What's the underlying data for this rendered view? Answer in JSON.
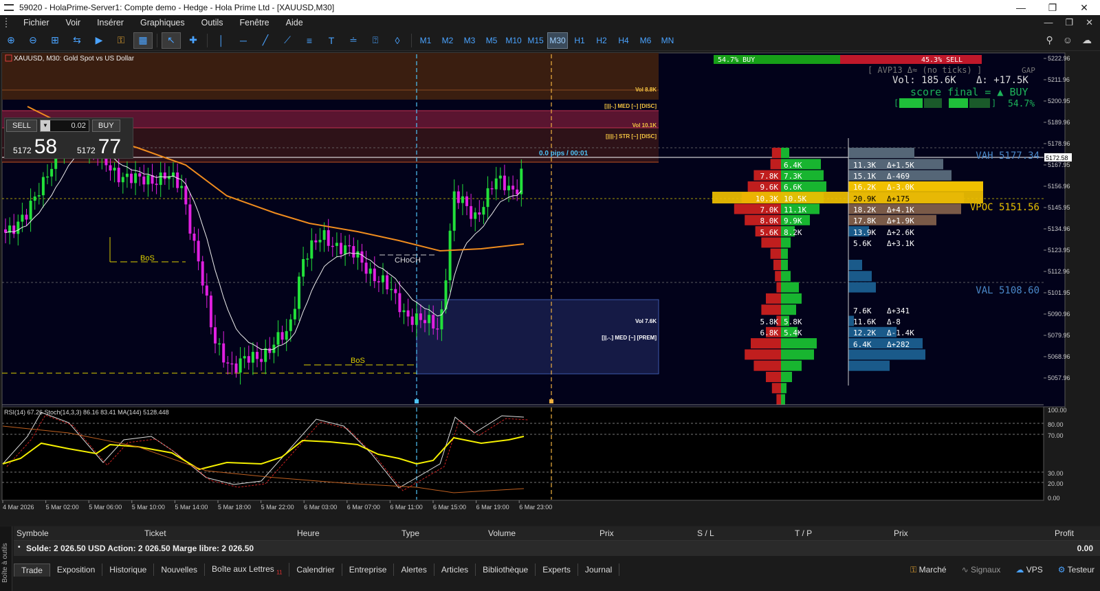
{
  "window": {
    "title": "59020 - HolaPrime-Server1: Compte demo - Hedge - Hola Prime Ltd - [XAUUSD,M30]"
  },
  "menu": [
    "Fichier",
    "Voir",
    "Insérer",
    "Graphiques",
    "Outils",
    "Fenêtre",
    "Aide"
  ],
  "timeframes": [
    "M1",
    "M2",
    "M3",
    "M5",
    "M10",
    "M15",
    "M30",
    "H1",
    "H2",
    "H4",
    "M6",
    "MN"
  ],
  "active_timeframe": "M30",
  "chart": {
    "symbol_label": "XAUUSD, M30:  Gold Spot vs US Dollar",
    "current_price_tag": "5172.58",
    "price_axis": [
      "5222.96",
      "5211.96",
      "5200.95",
      "5189.96",
      "5178.96",
      "5167.95",
      "5156.96",
      "5145.95",
      "5134.96",
      "5123.95",
      "5112.96",
      "5101.95",
      "5090.96",
      "5079.95",
      "5068.96",
      "5057.96"
    ],
    "time_axis": [
      "4 Mar 2026",
      "5 Mar 02:00",
      "5 Mar 06:00",
      "5 Mar 10:00",
      "5 Mar 14:00",
      "5 Mar 18:00",
      "5 Mar 22:00",
      "6 Mar 03:00",
      "6 Mar 07:00",
      "6 Mar 11:00",
      "6 Mar 15:00",
      "6 Mar 19:00",
      "6 Mar 23:00"
    ],
    "labels": {
      "bos1": "BoS",
      "bos2": "BoS",
      "choch": "CHoCH",
      "pips": "0.0 pips / 00:01",
      "vol88": "Vol 8.8K",
      "med_disc": "[|||-.] MED [~] [DISC]",
      "vol101": "Vol 10.1K",
      "str_disc": "[||||-] STR [~] [DISC]",
      "vol76": "Vol 7.6K",
      "med_prem": "[||.-.] MED [~] [PREM]"
    },
    "sentiment": {
      "buy_text": "54.7% BUY",
      "sell_text": "45.3% SELL",
      "buy_pct": 54.7,
      "avp": "[ AVP13  Δ≈ (no ticks) ]",
      "gap": "GAP",
      "vol": "Vol: 185.6K",
      "delta": "Δ: +17.5K",
      "score": "score final = ▲ BUY",
      "score_pct": "54.7%"
    },
    "profile_levels": {
      "vah": "VAH 5177.34",
      "vpoc": "VPOC 5151.56",
      "val": "VAL 5108.60"
    },
    "profile_left_rows": [
      {
        "sell": "",
        "buy": "6.4K"
      },
      {
        "sell": "7.8K",
        "buy": "7.3K"
      },
      {
        "sell": "9.6K",
        "buy": "6.6K"
      },
      {
        "sell": "10.3K",
        "buy": "10.5K"
      },
      {
        "sell": "7.0K",
        "buy": "11.1K"
      },
      {
        "sell": "8.0K",
        "buy": "9.9K"
      },
      {
        "sell": "5.6K",
        "buy": "8.2K"
      },
      {
        "sell": "5.8K",
        "buy": "5.8K"
      },
      {
        "sell": "6.8K",
        "buy": "5.4K"
      }
    ],
    "profile_right_rows": [
      {
        "vol": "11.3K",
        "delta": "Δ+1.5K"
      },
      {
        "vol": "15.1K",
        "delta": "Δ-469"
      },
      {
        "vol": "16.2K",
        "delta": "Δ-3.0K"
      },
      {
        "vol": "20.9K",
        "delta": "Δ+175"
      },
      {
        "vol": "18.2K",
        "delta": "Δ+4.1K"
      },
      {
        "vol": "17.8K",
        "delta": "Δ+1.9K"
      },
      {
        "vol": "13.9K",
        "delta": "Δ+2.6K"
      },
      {
        "vol": "5.6K",
        "delta": "Δ+3.1K"
      },
      {
        "vol": "7.6K",
        "delta": "Δ+341"
      },
      {
        "vol": "11.6K",
        "delta": "Δ-8"
      },
      {
        "vol": "12.2K",
        "delta": "Δ-1.4K"
      },
      {
        "vol": "6.4K",
        "delta": "Δ+282"
      }
    ]
  },
  "indicator": {
    "label": "RSI(14) 67.26 Stoch(14,3,3) 86.16 83.41 MA(144) 5128.448",
    "axis": [
      "100.00",
      "80.00",
      "70.00",
      "30.00",
      "20.00",
      "0.00"
    ]
  },
  "trade_panel": {
    "sell_label": "SELL",
    "buy_label": "BUY",
    "lot": "0.02",
    "sell_small": "5172",
    "sell_big": "58",
    "buy_small": "5172",
    "buy_big": "77"
  },
  "terminal": {
    "columns": [
      "Symbole",
      "Ticket",
      "Heure",
      "Type",
      "Volume",
      "Prix",
      "S / L",
      "T / P",
      "Prix",
      "Profit"
    ],
    "balance": "Solde: 2 026.50 USD  Action: 2 026.50  Marge libre: 2 026.50",
    "profit": "0.00",
    "side_label": "Boîte à outils",
    "tabs": [
      "Trade",
      "Exposition",
      "Historique",
      "Nouvelles",
      "Boîte aux Lettres",
      "Calendrier",
      "Entreprise",
      "Alertes",
      "Articles",
      "Bibliothèque",
      "Experts",
      "Journal"
    ],
    "mail_badge": "11",
    "right_items": [
      "Marché",
      "Signaux",
      "VPS",
      "Testeur"
    ]
  }
}
